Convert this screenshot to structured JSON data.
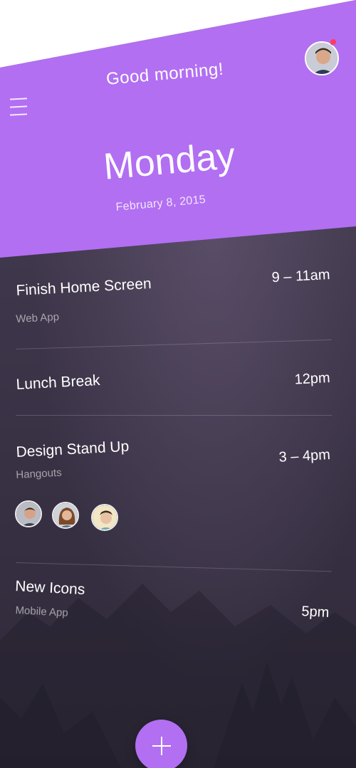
{
  "header": {
    "greeting": "Good morning!",
    "day": "Monday",
    "date": "February 8, 2015"
  },
  "events": [
    {
      "title": "Finish Home Screen",
      "subtitle": "Web App",
      "time": "9 – 11am"
    },
    {
      "title": "Lunch Break",
      "subtitle": "",
      "time": "12pm"
    },
    {
      "title": "Design Stand Up",
      "subtitle": "Hangouts",
      "time": "3 – 4pm"
    },
    {
      "title": "New Icons",
      "subtitle": "Mobile App",
      "time": "5pm"
    }
  ],
  "colors": {
    "accent": "#b26ff2",
    "background": "#3d3549",
    "notification": "#ff3b5c"
  },
  "icons": {
    "menu": "menu-icon",
    "add": "plus-icon"
  }
}
